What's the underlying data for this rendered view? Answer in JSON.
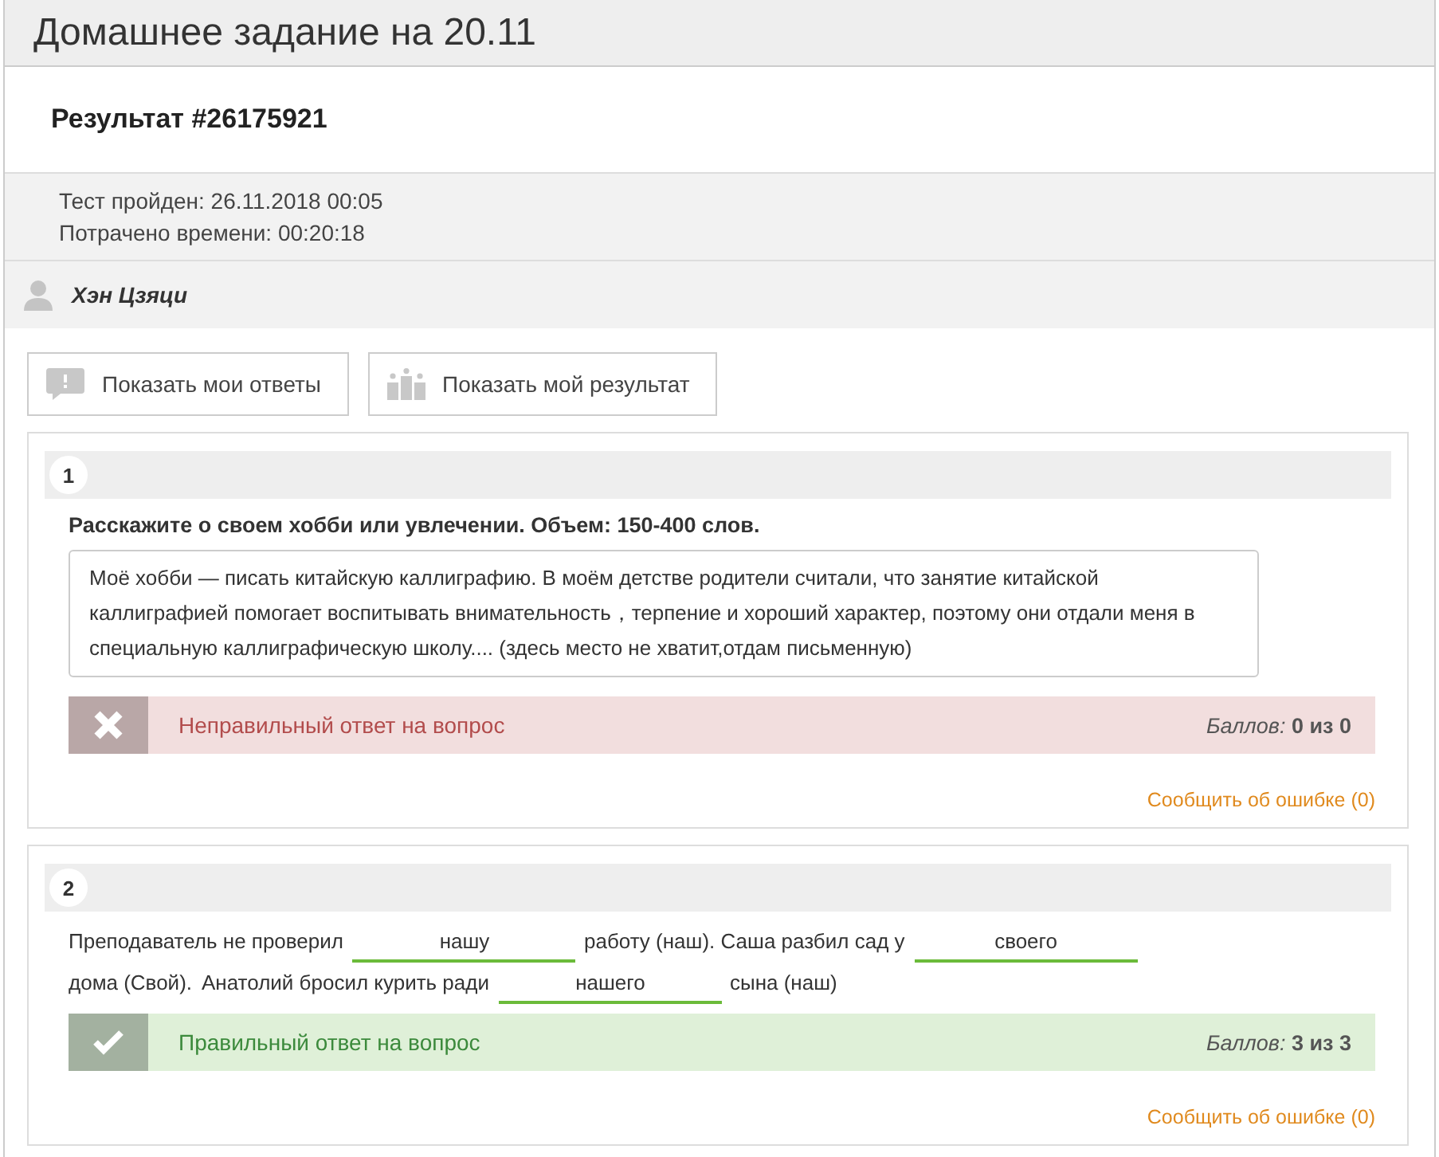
{
  "page_title": "Домашнее задание на 20.11",
  "result_heading": "Результат #26175921",
  "meta": [
    "Тест пройден: 26.11.2018 00:05",
    "Потрачено времени: 00:20:18"
  ],
  "user": {
    "name": "Хэн Цзяци"
  },
  "buttons": [
    {
      "kind": "answers",
      "label": "Показать мои ответы"
    },
    {
      "kind": "result",
      "label": "Показать мой результат"
    }
  ],
  "questions": [
    {
      "number": "1",
      "kind": "essay",
      "prompt": "Расскажите о своем хобби или увлечении. Объем: 150-400 слов.",
      "answer": "Моё хобби — писать китайскую каллиграфию.  В моём детстве родители считали, что занятие китайской каллиграфией помогает воспитывать внимательность，терпение и хороший характер, поэтому они отдали меня в специальную каллиграфическую школу.... (здесь место не хватит,отдам письменную)",
      "correct": false,
      "verdict": "Неправильный ответ на вопрос",
      "score_label": "Баллов:",
      "score": "0 из 0",
      "report": "Сообщить об ошибке (0)"
    },
    {
      "number": "2",
      "kind": "fill",
      "parts": [
        {
          "kind": "text",
          "text": "Преподаватель не проверил"
        },
        {
          "kind": "blank",
          "text": "нашу"
        },
        {
          "kind": "text",
          "text": "работу (наш). Саша разбил сад  у"
        },
        {
          "kind": "blank",
          "text": "своего"
        },
        {
          "kind": "text",
          "text": "дома (Свой)."
        },
        {
          "kind": "text",
          "text": "Анатолий бросил курить ради"
        },
        {
          "kind": "blank",
          "text": "нашего"
        },
        {
          "kind": "text",
          "text": "сына (наш)"
        }
      ],
      "correct": true,
      "verdict": "Правильный ответ на вопрос",
      "score_label": "Баллов:",
      "score": "3 из 3",
      "report": "Сообщить об ошибке (0)"
    }
  ]
}
